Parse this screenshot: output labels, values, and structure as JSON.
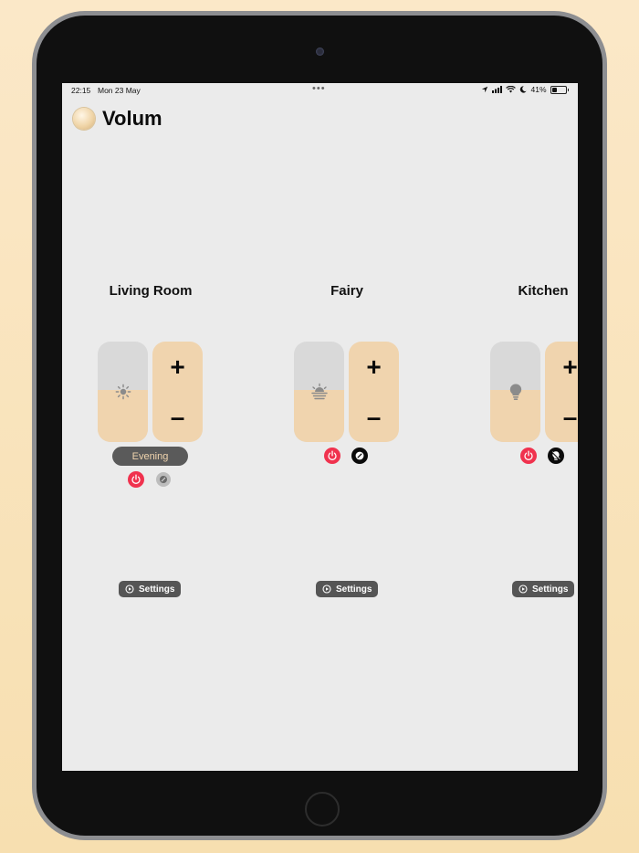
{
  "status_bar": {
    "time": "22:15",
    "date": "Mon 23 May",
    "dots": "•••",
    "battery": "41%",
    "battery_level": 0.41
  },
  "app": {
    "title": "Volum"
  },
  "rooms": [
    {
      "title": "Living Room",
      "brightness": 0.52,
      "slider_icon": "sun-icon",
      "scene": "Evening",
      "settings_label": "Settings",
      "plus": "+",
      "minus": "–"
    },
    {
      "title": "Fairy",
      "brightness": 0.52,
      "slider_icon": "sunrise-icon",
      "settings_label": "Settings",
      "plus": "+",
      "minus": "–"
    },
    {
      "title": "Kitchen",
      "brightness": 0.52,
      "slider_icon": "lightbulb-icon",
      "settings_label": "Settings",
      "plus": "+",
      "minus": "–"
    }
  ],
  "colors": {
    "accent": "#f0d4ae",
    "slider_track": "#d9d9d9",
    "power": "#f0324e",
    "screen_bg": "#ebebeb"
  }
}
